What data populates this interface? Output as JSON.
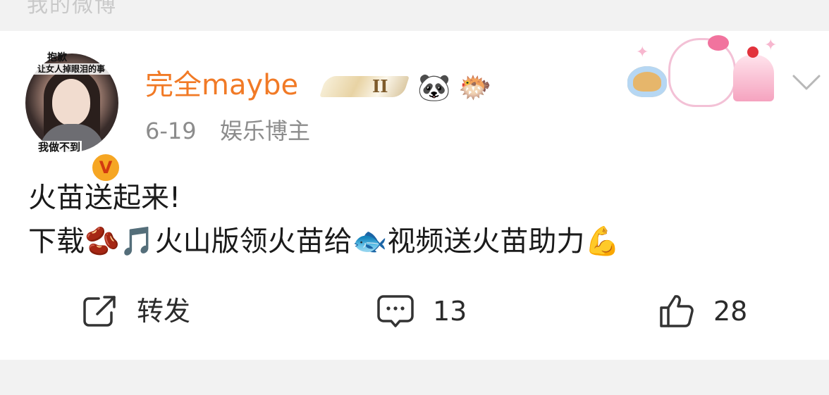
{
  "top_strip": {
    "cut_text": "我的微博"
  },
  "post": {
    "avatar": {
      "overlay_top": "抱歉",
      "overlay_top2": "让女人掉眼泪的事",
      "overlay_bottom": "我做不到",
      "verified_mark": "V"
    },
    "username": "完全maybe",
    "level_badge": "II",
    "emoji_badges": [
      "🐼",
      "🐡"
    ],
    "timestamp": "6-19",
    "category": "娱乐博主",
    "content_line1": "火苗送起来!",
    "content_line2": {
      "part1": "下载",
      "emoji1": "🫘",
      "emoji2": "🎵",
      "part2": "火山版领火苗给",
      "emoji3": "🐟",
      "part3": "视频送火苗助力",
      "emoji4": "💪"
    },
    "actions": {
      "repost_label": "转发",
      "comment_count": "13",
      "like_count": "28"
    }
  },
  "icons": {
    "repost": "share-out-icon",
    "comment": "comment-bubble-icon",
    "like": "thumbs-up-icon",
    "more": "chevron-down-icon"
  },
  "colors": {
    "username": "#f17a26",
    "secondary_text": "#8c8c8c",
    "background": "#f2f2f2",
    "card": "#ffffff"
  }
}
